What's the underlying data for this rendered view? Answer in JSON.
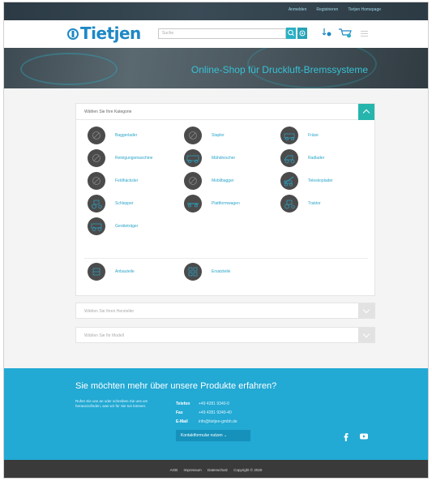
{
  "topbar": {
    "links": [
      "Anmelden",
      "Registrieren",
      "Tietjen Homepage"
    ]
  },
  "header": {
    "logo_text": "Tietjen",
    "search_placeholder": "Suche",
    "brand_color": "#1e88c6",
    "accent_color": "#2ab0c5"
  },
  "hero": {
    "title": "Online-Shop für Druckluft-Bremssysteme"
  },
  "categories": {
    "header_label": "Wählen Sie Ihre Kategorie",
    "items": [
      {
        "label": "Baggerlader",
        "icon": "circle-slash-icon"
      },
      {
        "label": "Stapler",
        "icon": "circle-slash-icon"
      },
      {
        "label": "Fräse",
        "icon": "milling-machine-icon"
      },
      {
        "label": "Reinigungsmaschine",
        "icon": "circle-slash-icon"
      },
      {
        "label": "Mähdrescher",
        "icon": "harvester-icon"
      },
      {
        "label": "Radlader",
        "icon": "wheel-loader-icon"
      },
      {
        "label": "Feldhäcksler",
        "icon": "circle-slash-icon"
      },
      {
        "label": "Mobilbagger",
        "icon": "circle-slash-icon"
      },
      {
        "label": "Teleskoplader",
        "icon": "telehandler-icon"
      },
      {
        "label": "Schlepper",
        "icon": "tractor-icon"
      },
      {
        "label": "Plattformwagen",
        "icon": "platform-trailer-icon"
      },
      {
        "label": "Traktor",
        "icon": "tractor-icon"
      },
      {
        "label": "Geräteträger",
        "icon": "tool-carrier-icon"
      }
    ],
    "extras": [
      {
        "label": "Anbauteile",
        "icon": "parts-icon"
      },
      {
        "label": "Ersatzteile",
        "icon": "spare-parts-icon"
      }
    ]
  },
  "filters": {
    "manufacturer_placeholder": "Wählen Sie Ihren Hersteller",
    "model_placeholder": "Wählen Sie Ihr Modell"
  },
  "footer": {
    "title": "Sie möchten mehr über unsere Produkte erfahren?",
    "text": "Rufen Sie uns an oder schreiben Sie uns um herauszufinden, was wir für Sie tun können.",
    "contact": [
      {
        "key": "Telefon",
        "value": "+49 4281 9340-0"
      },
      {
        "key": "Fax",
        "value": "+49 4281 9340-40"
      },
      {
        "key": "E-Mail",
        "value": "info@tietjen-gmbh.de"
      }
    ],
    "contact_button": "Kontaktformular nutzen",
    "bottom_links": [
      "AGB",
      "Impressum",
      "Datenschutz",
      "Copyright © 2020"
    ],
    "footer_color": "#22a9d4"
  }
}
